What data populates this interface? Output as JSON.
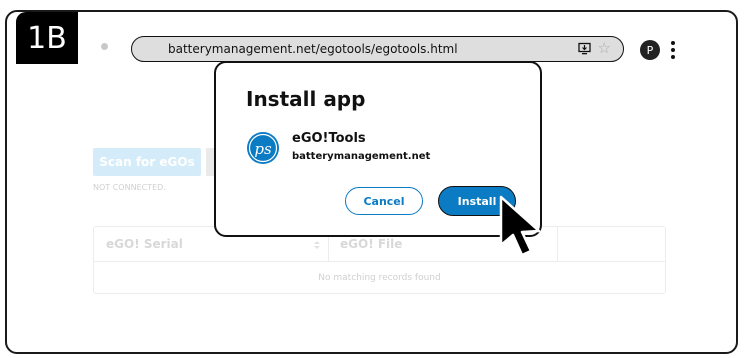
{
  "step_badge": "1B",
  "browser": {
    "url": "batterymanagement.net/egotools/egotools.html",
    "install_icon": "install-app-icon",
    "star_icon": "star-icon",
    "avatar_letter": "P",
    "menu_icon": "kebab-menu-icon"
  },
  "page": {
    "scan_button": "Scan for eGOs",
    "connection_status": "NOT CONNECTED.",
    "table": {
      "columns": [
        "eGO! Serial",
        "eGO! File"
      ],
      "empty_message": "No matching records found"
    }
  },
  "dialog": {
    "title": "Install app",
    "app_name": "eGO!Tools",
    "app_domain": "batterymanagement.net",
    "app_logo_text": "PS",
    "cancel_label": "Cancel",
    "install_label": "Install"
  },
  "colors": {
    "accent": "#0b7bc4",
    "scan_button_bg": "#d4ecf9",
    "url_bar_bg": "#dedede"
  },
  "cursor_icon": "mouse-pointer-icon"
}
